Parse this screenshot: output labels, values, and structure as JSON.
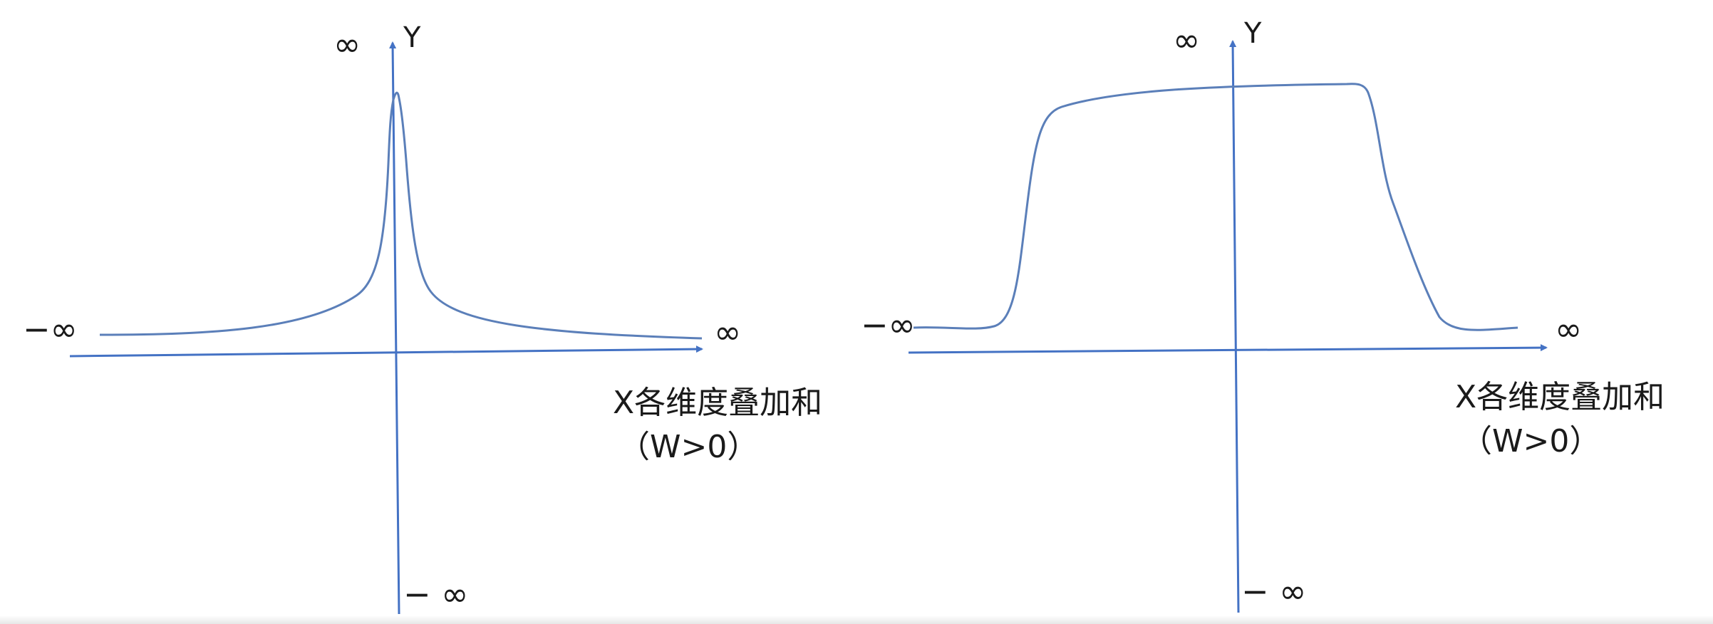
{
  "colors": {
    "axis": "#4472c4",
    "curve": "#5b7fb9",
    "text": "#1a1a1a"
  },
  "panels": [
    {
      "curve_shape": "sharp-peak",
      "y_axis_label": "Y",
      "y_top_label": "∞",
      "y_bottom_label": "− ∞",
      "x_left_label": "−∞",
      "x_right_label": "∞",
      "x_axis_label_line1": "X各维度叠加和",
      "x_axis_label_line2": "（W>0）"
    },
    {
      "curve_shape": "plateau",
      "y_axis_label": "Y",
      "y_top_label": "∞",
      "y_bottom_label": "− ∞",
      "x_left_label": "−∞",
      "x_right_label": "∞",
      "x_axis_label_line1": "X各维度叠加和",
      "x_axis_label_line2": "（W>0）"
    }
  ]
}
